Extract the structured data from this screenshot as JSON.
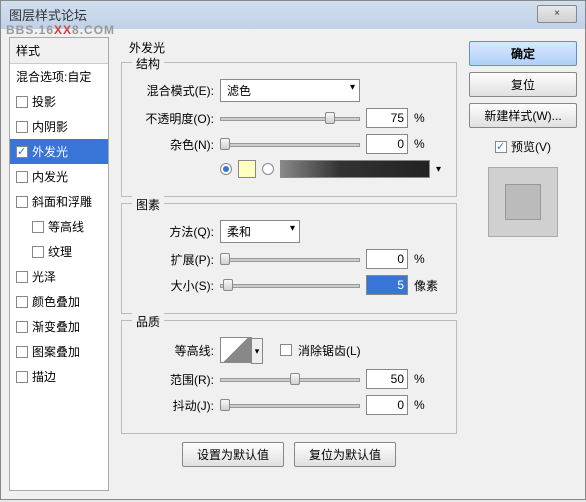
{
  "window": {
    "title": "图层样式论坛"
  },
  "watermark": {
    "prefix": "BBS.16",
    "mid": "XX",
    "suffix": "8.COM"
  },
  "close_label": "×",
  "left": {
    "header": "样式",
    "blend_options": "混合选项:自定",
    "items": [
      {
        "label": "投影",
        "checked": false
      },
      {
        "label": "内阴影",
        "checked": false
      },
      {
        "label": "外发光",
        "checked": true,
        "selected": true
      },
      {
        "label": "内发光",
        "checked": false
      },
      {
        "label": "斜面和浮雕",
        "checked": false
      },
      {
        "label": "等高线",
        "checked": false,
        "indent": true
      },
      {
        "label": "纹理",
        "checked": false,
        "indent": true
      },
      {
        "label": "光泽",
        "checked": false
      },
      {
        "label": "颜色叠加",
        "checked": false
      },
      {
        "label": "渐变叠加",
        "checked": false
      },
      {
        "label": "图案叠加",
        "checked": false
      },
      {
        "label": "描边",
        "checked": false
      }
    ]
  },
  "main": {
    "title": "外发光",
    "structure": {
      "legend": "结构",
      "blend_mode_label": "混合模式(E):",
      "blend_mode_value": "滤色",
      "opacity_label": "不透明度(O):",
      "opacity_value": "75",
      "opacity_unit": "%",
      "noise_label": "杂色(N):",
      "noise_value": "0",
      "noise_unit": "%",
      "color_hex": "#ffffbe"
    },
    "elements": {
      "legend": "图素",
      "method_label": "方法(Q):",
      "method_value": "柔和",
      "spread_label": "扩展(P):",
      "spread_value": "0",
      "spread_unit": "%",
      "size_label": "大小(S):",
      "size_value": "5",
      "size_unit": "像素"
    },
    "quality": {
      "legend": "品质",
      "contour_label": "等高线:",
      "antialiased_label": "消除锯齿(L)",
      "range_label": "范围(R):",
      "range_value": "50",
      "range_unit": "%",
      "jitter_label": "抖动(J):",
      "jitter_value": "0",
      "jitter_unit": "%"
    },
    "buttons": {
      "set_default": "设置为默认值",
      "reset_default": "复位为默认值"
    }
  },
  "right": {
    "ok": "确定",
    "cancel": "复位",
    "new_style": "新建样式(W)...",
    "preview_label": "预览(V)"
  }
}
